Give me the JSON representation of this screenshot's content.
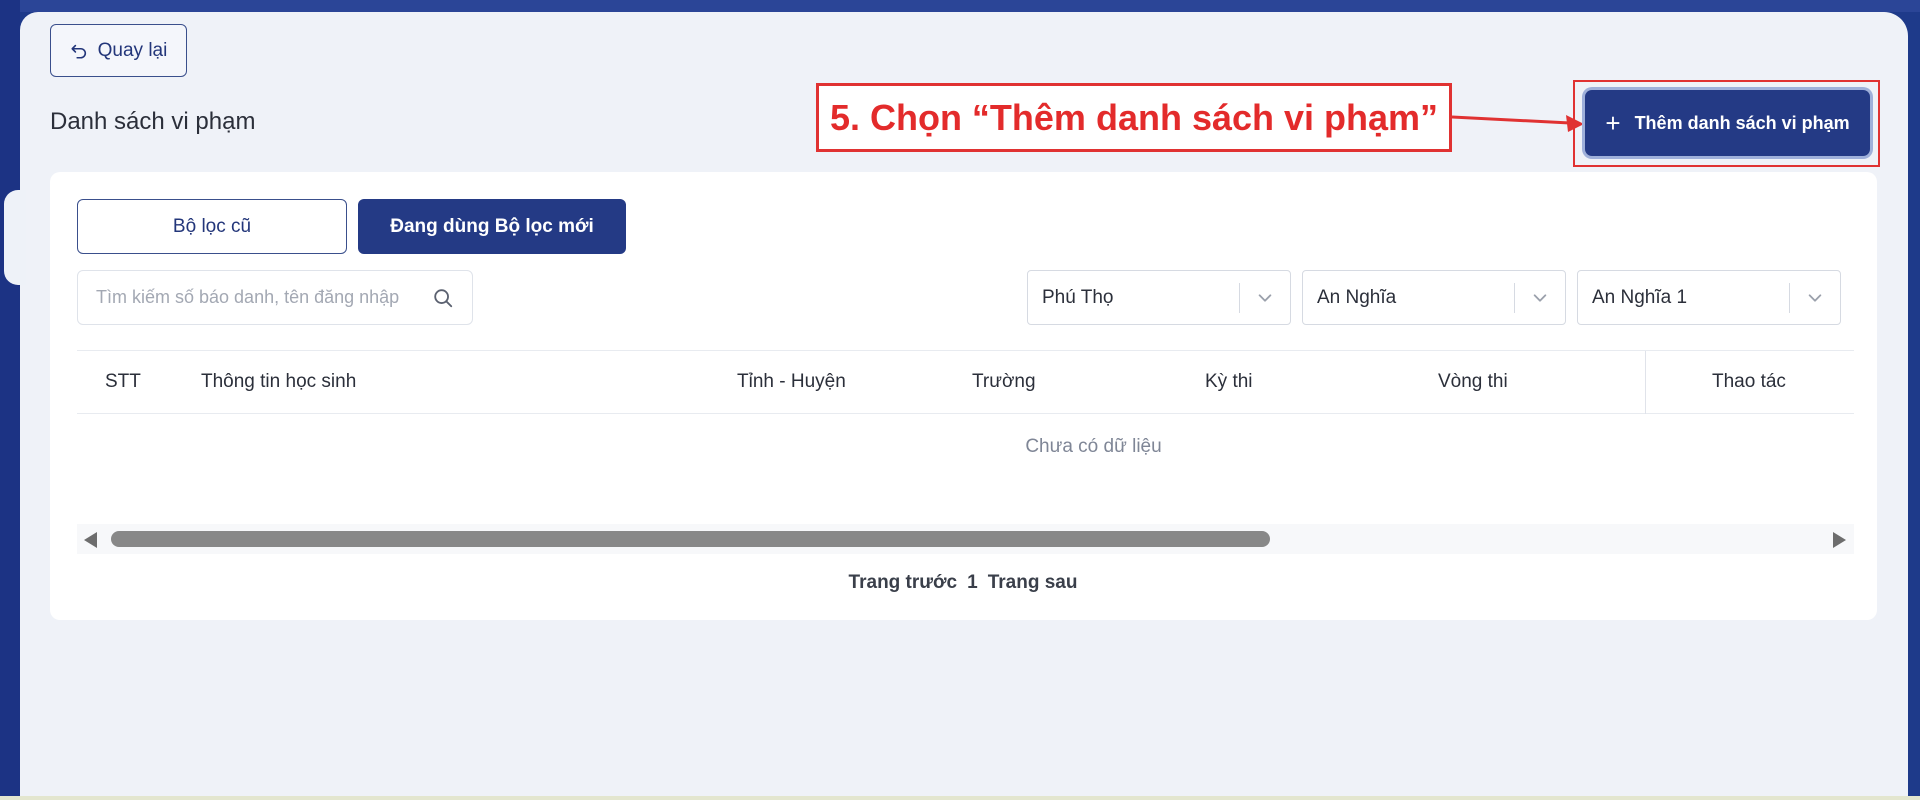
{
  "back_button": {
    "label": "Quay lại",
    "icon": "undo-arrow-icon"
  },
  "page": {
    "title": "Danh sách vi phạm"
  },
  "annotation": {
    "text": "5. Chọn “Thêm danh sách vi phạm”",
    "color": "#e32b2b"
  },
  "add_button": {
    "icon": "plus-icon",
    "plus": "+",
    "label": "Thêm danh sách vi phạm"
  },
  "filters": {
    "old_label": "Bộ lọc cũ",
    "new_label": "Đang dùng Bộ lọc mới"
  },
  "search": {
    "placeholder": "Tìm kiếm số báo danh, tên đăng nhập",
    "icon": "search-icon"
  },
  "selects": [
    {
      "value": "Phú Thọ"
    },
    {
      "value": "An Nghĩa"
    },
    {
      "value": "An Nghĩa 1"
    }
  ],
  "table": {
    "columns": [
      "STT",
      "Thông tin học sinh",
      "Tỉnh - Huyện",
      "Trường",
      "Kỳ thi",
      "Vòng thi",
      "Thao tác"
    ],
    "empty_text": "Chưa có dữ liệu"
  },
  "pagination": {
    "prev": "Trang trước",
    "current": "1",
    "next": "Trang sau"
  },
  "colors": {
    "primary": "#243a85",
    "background": "#eff2f8",
    "annotation": "#e03232"
  }
}
